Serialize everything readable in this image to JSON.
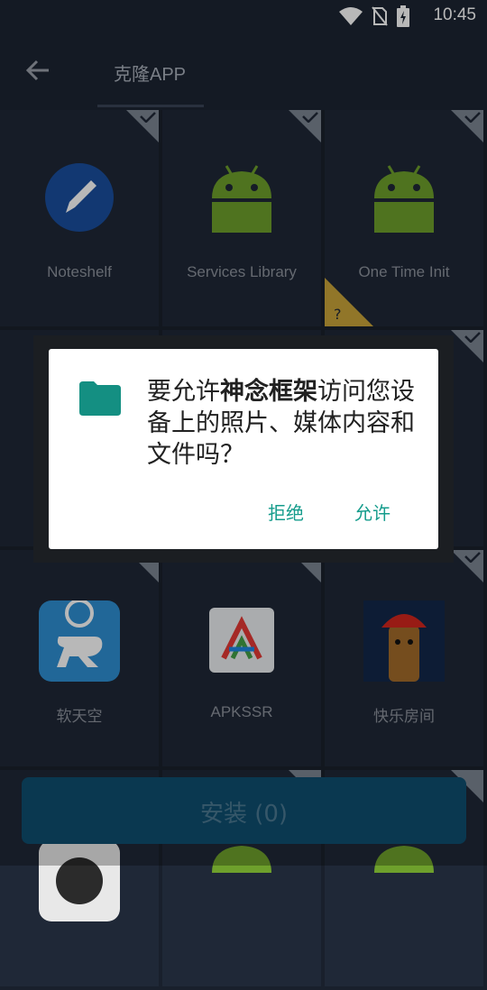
{
  "status": {
    "time": "10:45"
  },
  "header": {
    "title": "克隆APP"
  },
  "apps": [
    {
      "label": "Noteshelf"
    },
    {
      "label": "Services Library"
    },
    {
      "label": "One Time Init"
    },
    {
      "label": "软天空"
    },
    {
      "label": "APKSSR"
    },
    {
      "label": "快乐房间"
    }
  ],
  "dialog": {
    "prefix": "要允许",
    "app_name": "神念框架",
    "suffix": "访问您设备上的照片、媒体内容和文件吗？",
    "deny": "拒绝",
    "allow": "允许"
  },
  "install": {
    "label": "安装 (0)"
  },
  "colors": {
    "accent": "#159c8c",
    "install": "#0e4e70",
    "background": "#1d2533"
  }
}
